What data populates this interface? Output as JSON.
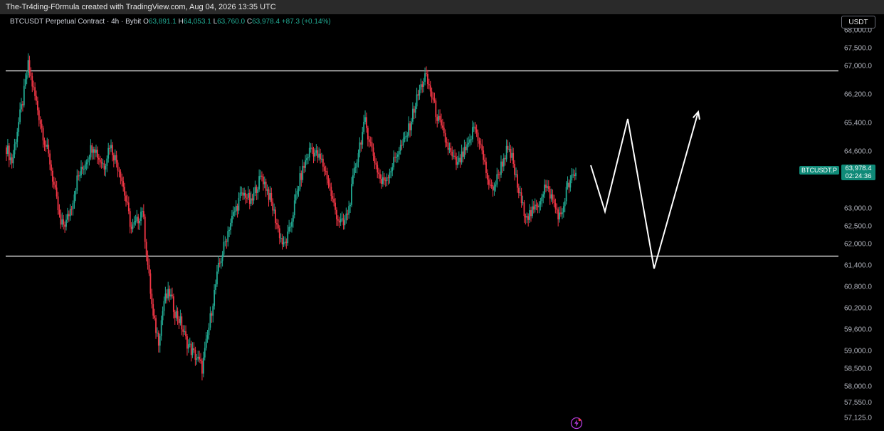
{
  "header": {
    "text": "The-Tr4ding-F0rmula created with TradingView.com, Aug 04, 2026 13:35 UTC"
  },
  "legend": {
    "symbol": "BTCUSDT Perpetual Contract · 4h · Bybit",
    "o_key": "O",
    "o": "63,891.1",
    "h_key": "H",
    "h": "64,053.1",
    "l_key": "L",
    "l": "63,760.0",
    "c_key": "C",
    "c": "63,978.4",
    "change": "+87.3 (+0.14%)"
  },
  "currency_button": "USDT",
  "price_tag": {
    "symbol": "BTCUSDT.P",
    "price": "63,978.4",
    "countdown": "02:24:36"
  },
  "colors": {
    "up": "#22ab94",
    "down": "#f23645",
    "background": "#000000",
    "line": "#ffffff",
    "tag": "#0f8a78"
  },
  "icons": {
    "bottom": "bolt-icon"
  },
  "chart_data": {
    "type": "candlestick",
    "yticks": [
      {
        "v": 68000,
        "label": "68,000.0"
      },
      {
        "v": 67500,
        "label": "67,500.0"
      },
      {
        "v": 67000,
        "label": "67,000.0"
      },
      {
        "v": 66200,
        "label": "66,200.0"
      },
      {
        "v": 65400,
        "label": "65,400.0"
      },
      {
        "v": 64600,
        "label": "64,600.0"
      },
      {
        "v": 63000,
        "label": "63,000.0"
      },
      {
        "v": 62500,
        "label": "62,500.0"
      },
      {
        "v": 62000,
        "label": "62,000.0"
      },
      {
        "v": 61400,
        "label": "61,400.0"
      },
      {
        "v": 60800,
        "label": "60,800.0"
      },
      {
        "v": 60200,
        "label": "60,200.0"
      },
      {
        "v": 59600,
        "label": "59,600.0"
      },
      {
        "v": 59000,
        "label": "59,000.0"
      },
      {
        "v": 58500,
        "label": "58,500.0"
      },
      {
        "v": 58000,
        "label": "58,000.0"
      },
      {
        "v": 57550,
        "label": "57,550.0"
      },
      {
        "v": 57125,
        "label": "57,125.0"
      }
    ],
    "last_price": 63978.4,
    "horizontal_levels": [
      66850,
      61650
    ],
    "price_path": [
      64700,
      64300,
      65200,
      66000,
      67000,
      66300,
      65600,
      64900,
      64300,
      63400,
      62500,
      62600,
      63100,
      63800,
      64100,
      64500,
      64800,
      64400,
      64200,
      64800,
      64400,
      64000,
      63200,
      62400,
      62600,
      63000,
      61400,
      59900,
      59300,
      60400,
      60600,
      60100,
      59800,
      59300,
      59000,
      58800,
      58500,
      59400,
      60400,
      61300,
      61900,
      62500,
      62900,
      63300,
      63400,
      63100,
      63600,
      63900,
      63500,
      63000,
      62400,
      61900,
      62300,
      63100,
      63800,
      64300,
      64700,
      64500,
      64300,
      63900,
      63200,
      62700,
      62500,
      63000,
      64000,
      64800,
      65400,
      64800,
      64200,
      63700,
      63900,
      64200,
      64600,
      64800,
      65200,
      65800,
      66300,
      66700,
      66300,
      65700,
      65200,
      64800,
      64400,
      64200,
      64500,
      64700,
      65300,
      64900,
      64200,
      63500,
      63700,
      64200,
      64600,
      64400,
      63600,
      63000,
      62800,
      62900,
      63200,
      63600,
      63400,
      63000,
      62700,
      63500,
      63800,
      63978.4
    ],
    "projection_path": [
      [
        810,
        64200
      ],
      [
        830,
        62900
      ],
      [
        862,
        65500
      ],
      [
        899,
        61300
      ],
      [
        961,
        65700
      ]
    ]
  }
}
